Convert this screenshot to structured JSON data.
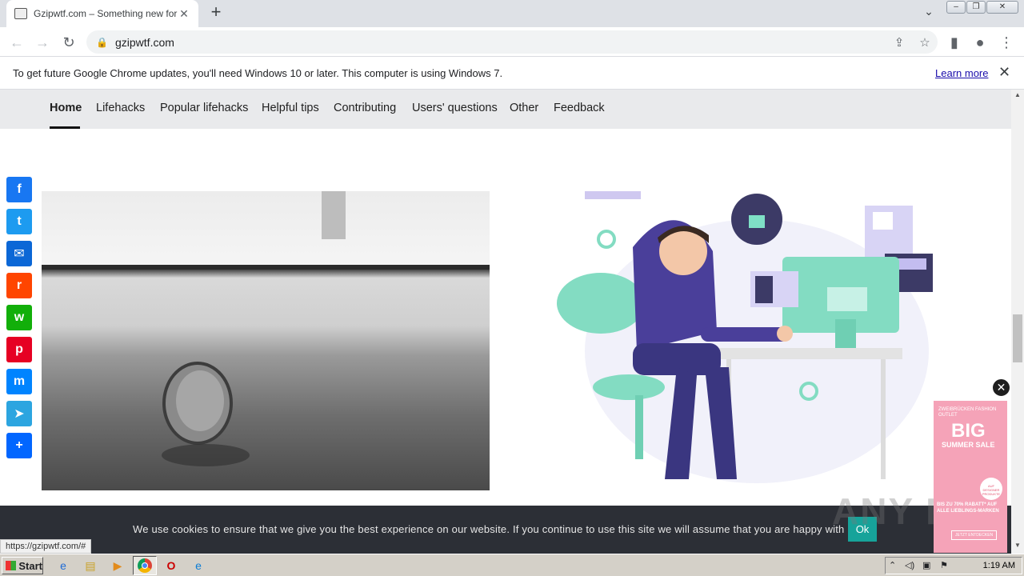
{
  "browser": {
    "tab_title": "Gzipwtf.com – Something new for ev",
    "new_tab_symbol": "+",
    "url": "gzipwtf.com",
    "status_url": "https://gzipwtf.com/#"
  },
  "infobar": {
    "message": "To get future Google Chrome updates, you'll need Windows 10 or later. This computer is using Windows 7.",
    "learn_more": "Learn more"
  },
  "nav": {
    "items": [
      "Home",
      "Lifehacks",
      "Popular lifehacks",
      "Helpful tips",
      "Contributing",
      "Users' questions",
      "Other",
      "Feedback"
    ],
    "active": "Home"
  },
  "share": {
    "buttons": [
      {
        "name": "facebook",
        "glyph": "f",
        "color": "#1877f2"
      },
      {
        "name": "twitter",
        "glyph": "t",
        "color": "#1d9bf0"
      },
      {
        "name": "email",
        "glyph": "✉",
        "color": "#0b67d6"
      },
      {
        "name": "reddit",
        "glyph": "r",
        "color": "#ff4500"
      },
      {
        "name": "whatsapp",
        "glyph": "w",
        "color": "#12af0a"
      },
      {
        "name": "pinterest",
        "glyph": "p",
        "color": "#e60023"
      },
      {
        "name": "messenger",
        "glyph": "m",
        "color": "#0084ff"
      },
      {
        "name": "telegram",
        "glyph": "➤",
        "color": "#2ca5e0"
      },
      {
        "name": "share",
        "glyph": "+",
        "color": "#0166ff"
      }
    ]
  },
  "cookie": {
    "text": "We use cookies to ensure that we give you the best experience on our website. If you continue to use this site we will assume that you are happy with it.",
    "ok": "Ok"
  },
  "ad": {
    "brand": "ZWEIBRÜCKEN FASHION OUTLET",
    "headline": "BIG",
    "subheadline": "SUMMER SALE",
    "badge": "AUF DESIGNER PRODUKTE",
    "discount": "BIS ZU 70% RABATT* AUF ALLE LIEBLINGS-MARKEN",
    "cta": "JETZT ENTDECKEN"
  },
  "watermark": "ANY RUN",
  "taskbar": {
    "start": "Start",
    "clock": "1:19 AM"
  }
}
